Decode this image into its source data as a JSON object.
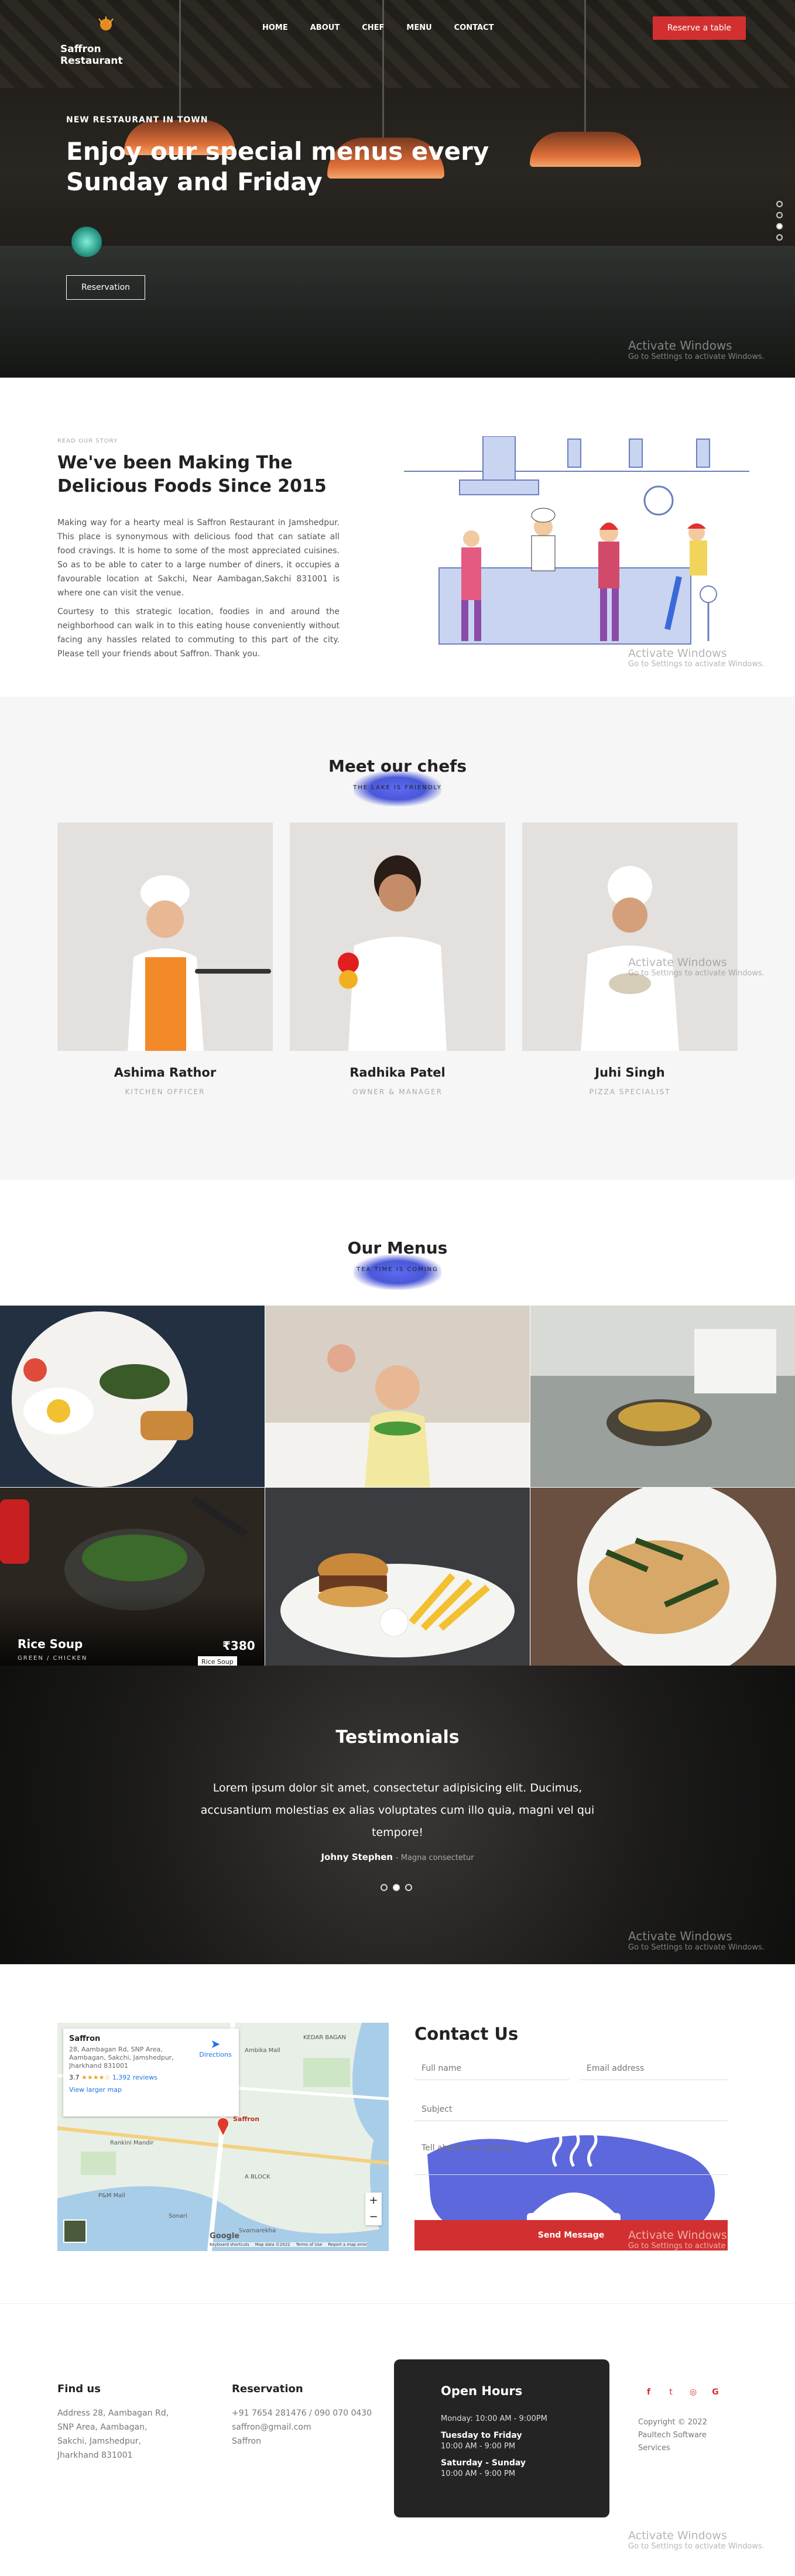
{
  "header": {
    "logo_text": "Saffron Restaurant",
    "nav": [
      "HOME",
      "ABOUT",
      "CHEF",
      "MENU",
      "CONTACT"
    ],
    "reserve_button": "Reserve a table"
  },
  "hero": {
    "kicker": "NEW RESTAURANT IN TOWN",
    "title": "Enjoy our special menus every Sunday and Friday",
    "button": "Reservation",
    "slides_total": 4,
    "slide_active": 3
  },
  "windows_watermark": {
    "title": "Activate Windows",
    "subtitle": "Go to Settings to activate Windows."
  },
  "story": {
    "kicker": "READ OUR STORY",
    "title": "We've been Making The Delicious Foods Since 2015",
    "paragraph1": "Making way for a hearty meal is Saffron Restaurant in Jamshedpur. This place is synonymous with delicious food that can satiate all food cravings. It is home to some of the most appreciated cuisines. So as to be able to cater to a large number of diners, it occupies a favourable location at Sakchi, Near Aambagan,Sakchi 831001 is where one can visit the venue.",
    "paragraph2": "Courtesy to this strategic location, foodies in and around the neighborhood can walk in to this eating house conveniently without facing any hassles related to commuting to this part of the city. Please tell your friends about Saffron. Thank you."
  },
  "chefs": {
    "title": "Meet our chefs",
    "brush_label": "THE LAKE IS FRIENDLY",
    "items": [
      {
        "name": "Ashima Rathor",
        "role": "KITCHEN OFFICER"
      },
      {
        "name": "Radhika Patel",
        "role": "OWNER & MANAGER"
      },
      {
        "name": "Juhi Singh",
        "role": "PIZZA SPECIALIST"
      }
    ]
  },
  "menus": {
    "title": "Our Menus",
    "brush_label": "TEA TIME IS COMING",
    "featured": {
      "name": "Rice Soup",
      "sub": "GREEN / CHICKEN",
      "price": "₹380",
      "tag": "Rice Soup"
    }
  },
  "testimonials": {
    "title": "Testimonials",
    "text": "Lorem ipsum dolor sit amet, consectetur adipisicing elit. Ducimus, accusantium molestias ex alias voluptates cum illo quia, magni vel qui tempore!",
    "author": "Johny Stephen",
    "author_role": "- Magna consectetur",
    "slides_total": 3,
    "slide_active": 2
  },
  "contact": {
    "title": "Contact Us",
    "full_name": "Full name",
    "email": "Email address",
    "subject": "Subject",
    "message": "Tell about your project",
    "send": "Send Message",
    "map": {
      "place": "Saffron",
      "address": "28, Aambagan Rd, SNP Area, Aambagan, Sakchi, Jamshedpur, Jharkhand 831001",
      "rating": "3.7",
      "stars": "★★★★☆",
      "reviews": "1,392 reviews",
      "directions": "Directions",
      "larger": "View larger map",
      "pin": "Saffron",
      "labels": [
        "KEDAR BAGAN",
        "Ambika Mall",
        "Rankini Mandir",
        "A BLOCK",
        "P&M Mall",
        "Sonari",
        "Svarnarekha"
      ],
      "footer": [
        "Keyboard shortcuts",
        "Map data ©2022",
        "Terms of Use",
        "Report a map error"
      ],
      "google": "Google"
    }
  },
  "footer": {
    "find_us": "Find us",
    "address": "Address 28, Aambagan Rd, SNP Area, Aambagan, Sakchi, Jamshedpur, Jharkhand 831001",
    "reservation": "Reservation",
    "phone": "+91 7654 281476 / 090 070 0430",
    "email": "saffron@gmail.com",
    "brand": "Saffron",
    "hours_title": "Open Hours",
    "hours": [
      {
        "day": "Monday: 10:00 AM - 9:00PM",
        "bold": false
      },
      {
        "day": "Tuesday to Friday",
        "bold": true
      },
      {
        "day": "10:00 AM - 9:00 PM",
        "bold": false
      },
      {
        "day": "Saturday - Sunday",
        "bold": true
      },
      {
        "day": "10:00 AM - 9:00 PM",
        "bold": false
      }
    ],
    "copyright": "Copyright © 2022 Paultech Software Services"
  },
  "colors": {
    "accent": "#d23030",
    "brush": "#4a58d8",
    "dark": "#242424"
  }
}
